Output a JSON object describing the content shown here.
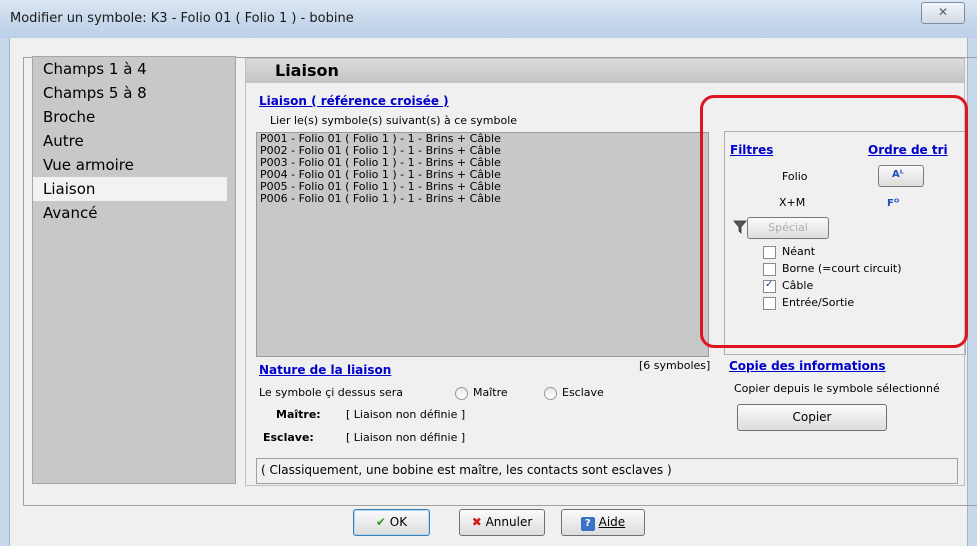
{
  "window": {
    "title": "Modifier un symbole: K3 - Folio 01 ( Folio 1 ) - bobine",
    "close_glyph": "✕"
  },
  "nav": {
    "items": [
      "Champs 1 à 4",
      "Champs 5 à 8",
      "Broche",
      "Autre",
      "Vue armoire",
      "Liaison",
      "Avancé"
    ],
    "selected": "Liaison"
  },
  "panel": {
    "title": "Liaison",
    "crossref_title": "Liaison ( référence croisée )",
    "crossref_desc": "Lier le(s) symbole(s) suivant(s) à ce symbole",
    "list": [
      "P001 - Folio 01 ( Folio 1 ) - 1 - Brins + Câble",
      "P002 - Folio 01 ( Folio 1 ) - 1 - Brins + Câble",
      "P003 - Folio 01 ( Folio 1 ) - 1 - Brins + Câble",
      "P004 - Folio 01 ( Folio 1 ) - 1 - Brins + Câble",
      "P005 - Folio 01 ( Folio 1 ) - 1 - Brins + Câble",
      "P006 - Folio 01 ( Folio 1 ) - 1 - Brins + Câble"
    ],
    "count": "[6 symboles]"
  },
  "filters": {
    "title": "Filtres",
    "sort_title": "Ordre de tri",
    "folio": "Folio",
    "xm": "X+M",
    "special_button": "Spécial",
    "sort_icon_a": "Aᴸ",
    "sort_icon_b": "Fᴼ",
    "checks": [
      {
        "label": "Néant",
        "checked": false
      },
      {
        "label": "Borne (=court circuit)",
        "checked": false
      },
      {
        "label": "Câble",
        "checked": true
      },
      {
        "label": "Entrée/Sortie",
        "checked": false
      }
    ],
    "check_mark": "✓"
  },
  "nature": {
    "title": "Nature de la liaison",
    "prompt": "Le symbole çi dessus sera",
    "option_master": "Maître",
    "option_slave": "Esclave",
    "master_label": "Maître:",
    "master_value": "[ Liaison non définie ]",
    "slave_label": "Esclave:",
    "slave_value": "[ Liaison non définie ]"
  },
  "copy": {
    "title": "Copie des informations",
    "desc": "Copier depuis le symbole sélectionné",
    "button": "Copier"
  },
  "info": "( Classiquement, une bobine est maître, les contacts sont esclaves )",
  "footer": {
    "ok": "OK",
    "cancel": "Annuler",
    "help": "Aide",
    "ok_glyph": "✔",
    "cancel_glyph": "✖",
    "help_glyph": "?"
  }
}
